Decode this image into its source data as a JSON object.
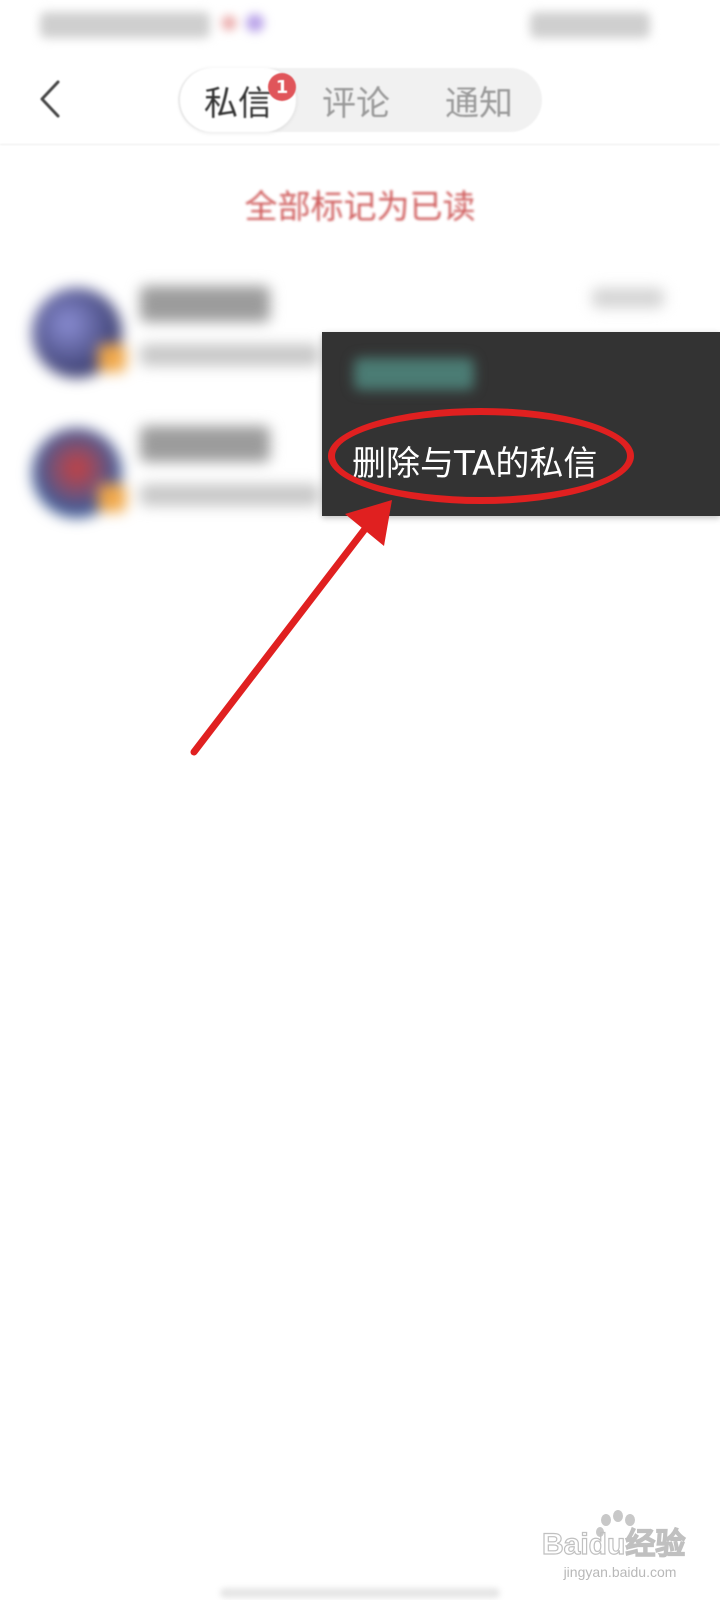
{
  "header": {
    "tabs": [
      {
        "label": "私信",
        "active": true,
        "badge": "1"
      },
      {
        "label": "评论",
        "active": false
      },
      {
        "label": "通知",
        "active": false
      }
    ]
  },
  "actions": {
    "mark_all_read": "全部标记为已读"
  },
  "context_menu": {
    "delete_label": "删除与TA的私信"
  },
  "annotation": {
    "color": "#e02020"
  },
  "watermark": {
    "logo_text": "Baidu经验",
    "subtitle": "jingyan.baidu.com"
  },
  "colors": {
    "accent": "#d06060",
    "badge": "#e0555a",
    "menu_bg": "#333333"
  }
}
